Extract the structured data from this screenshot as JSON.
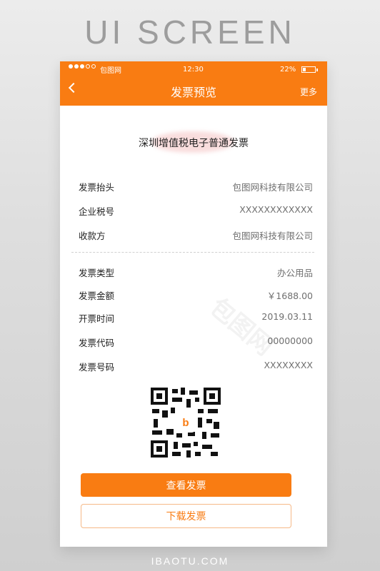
{
  "banner_title": "UI SCREEN",
  "footer_brand": "IBAOTU.COM",
  "status_bar": {
    "carrier": "包图网",
    "time": "12:30",
    "battery_percent": "22%",
    "battery_level": 0.22
  },
  "nav": {
    "title": "发票预览",
    "more_label": "更多",
    "back_icon": "chevron-left-icon"
  },
  "invoice": {
    "title": "深圳增值税电子普通发票",
    "rows_top": [
      {
        "label": "发票抬头",
        "value": "包图网科技有限公司"
      },
      {
        "label": "企业税号",
        "value": "XXXXXXXXXXXX"
      },
      {
        "label": "收款方",
        "value": "包图网科技有限公司"
      }
    ],
    "rows_bottom": [
      {
        "label": "发票类型",
        "value": "办公用品"
      },
      {
        "label": "发票金额",
        "value": "￥1688.00"
      },
      {
        "label": "开票时间",
        "value": "2019.03.11"
      },
      {
        "label": "发票代码",
        "value": "00000000"
      },
      {
        "label": "发票号码",
        "value": "XXXXXXXX"
      }
    ],
    "qr_logo": "b"
  },
  "buttons": {
    "view": "查看发票",
    "download": "下载发票"
  },
  "watermark": "包图网",
  "colors": {
    "accent": "#f97c12",
    "button_border": "#f6b988",
    "label": "#222222",
    "value": "#6f6f6f"
  }
}
